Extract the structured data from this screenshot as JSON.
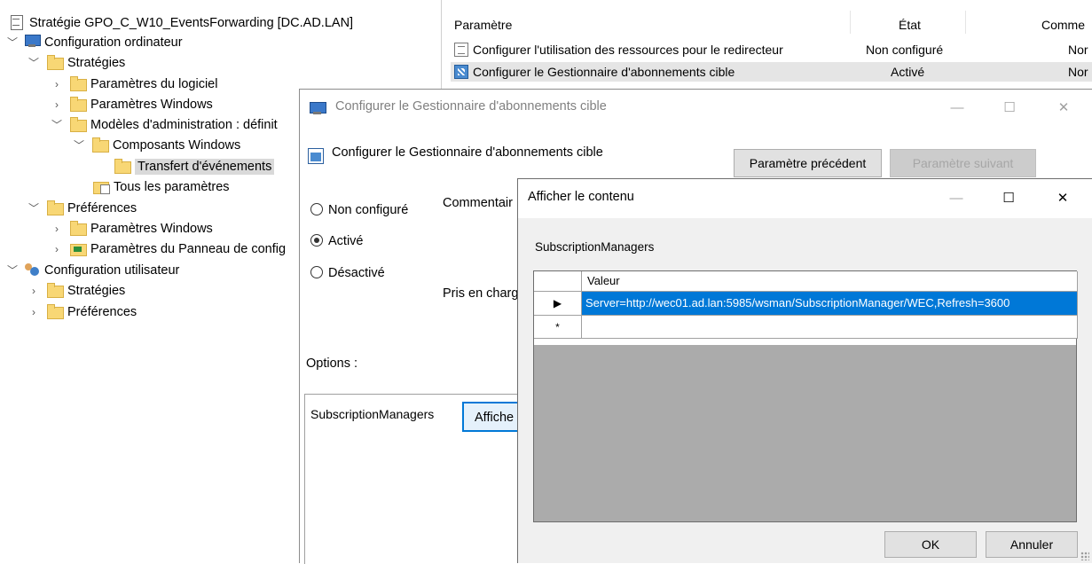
{
  "tree": {
    "root": "Stratégie GPO_C_W10_EventsForwarding [DC.AD.LAN]",
    "computer_config": "Configuration ordinateur",
    "policies": "Stratégies",
    "software_settings": "Paramètres du logiciel",
    "windows_settings": "Paramètres Windows",
    "admin_templates": "Modèles d'administration : définit",
    "windows_components": "Composants Windows",
    "event_forwarding": "Transfert d'événements",
    "all_settings": "Tous les paramètres",
    "preferences": "Préférences",
    "pref_windows_settings": "Paramètres Windows",
    "pref_control_panel": "Paramètres du Panneau de config",
    "user_config": "Configuration utilisateur",
    "user_policies": "Stratégies",
    "user_preferences": "Préférences"
  },
  "list": {
    "columns": [
      "Paramètre",
      "État",
      "Comme"
    ],
    "rows": [
      {
        "name": "Configurer l'utilisation des ressources pour le redirecteur",
        "state": "Non configuré",
        "comment": "Nor"
      },
      {
        "name": "Configurer le Gestionnaire d'abonnements cible",
        "state": "Activé",
        "comment": "Nor"
      }
    ]
  },
  "policy_dialog": {
    "title": "Configurer le Gestionnaire d'abonnements cible",
    "header": "Configurer le Gestionnaire d'abonnements cible",
    "prev_button": "Paramètre précédent",
    "next_button": "Paramètre suivant",
    "radio_not_configured": "Non configuré",
    "radio_enabled": "Activé",
    "radio_disabled": "Désactivé",
    "comment_label": "Commentair",
    "supported_label": "Pris en charg",
    "options_label": "Options :",
    "option_name": "SubscriptionManagers",
    "show_button": "Affiche",
    "selected_radio": "Activé"
  },
  "content_dialog": {
    "title": "Afficher le contenu",
    "subtitle": "SubscriptionManagers",
    "column_header": "Valeur",
    "value_row_marker": "▶",
    "new_row_marker": "*",
    "value": "Server=http://wec01.ad.lan:5985/wsman/SubscriptionManager/WEC,Refresh=3600",
    "ok_button": "OK",
    "cancel_button": "Annuler"
  },
  "icons": {
    "minimize": "—",
    "maximize": "☐",
    "close": "✕"
  },
  "colors": {
    "selection_blue": "#0078d7",
    "focus_button_bg": "#e5f1fb",
    "folder_yellow": "#f8d775"
  }
}
